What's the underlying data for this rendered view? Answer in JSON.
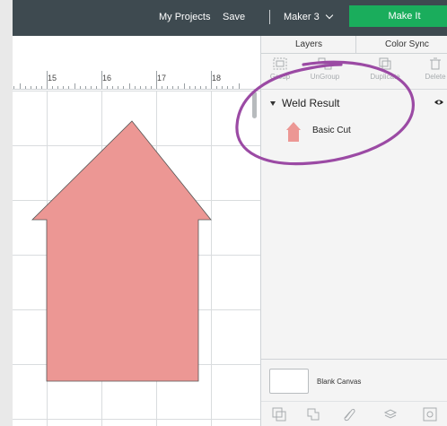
{
  "topbar": {
    "my_projects": "My Projects",
    "save": "Save",
    "separator": "|",
    "machine": "Maker 3",
    "make_it": "Make It"
  },
  "ruler": {
    "marks": [
      "15",
      "16",
      "17",
      "18"
    ]
  },
  "panel": {
    "tabs": {
      "layers": "Layers",
      "color_sync": "Color Sync"
    },
    "tools": {
      "group": "Group",
      "ungroup": "UnGroup",
      "duplicate": "Duplicate",
      "delete": "Delete"
    },
    "layer_group": {
      "title": "Weld Result"
    },
    "layer_item": {
      "label": "Basic Cut"
    },
    "blank_canvas": {
      "label": "Blank Canvas"
    }
  },
  "colors": {
    "shape_fill": "#ec9794",
    "shape_stroke": "#555555",
    "topbar": "#3e4a50",
    "make_it": "#1aad5c",
    "annotation": "#9b4aa4"
  },
  "icons": {
    "machine_dropdown": "chevron-down-icon",
    "layer_caret": "caret-down-icon",
    "visibility": "eye-icon"
  }
}
